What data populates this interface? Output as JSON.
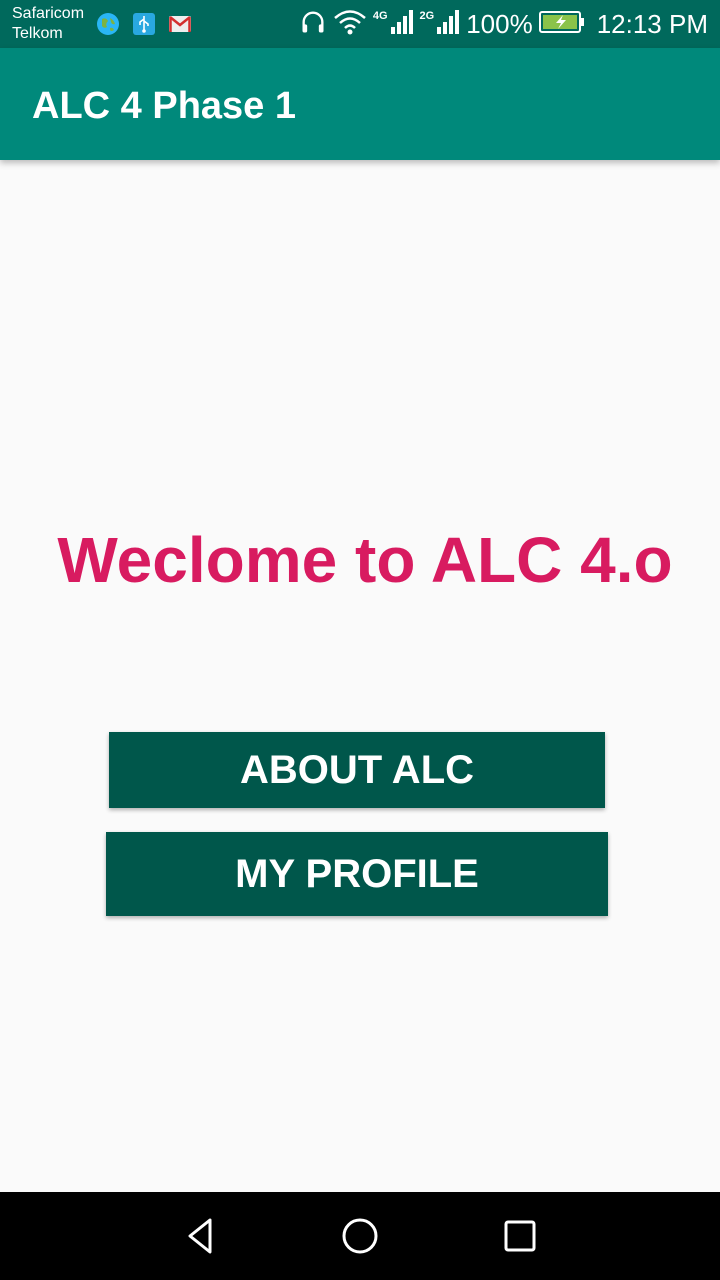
{
  "status_bar": {
    "carrier_1": "Safaricom",
    "carrier_2": "Telkom",
    "network_1": "4G",
    "network_2": "2G",
    "battery": "100%",
    "time": "12:13 PM",
    "icons": [
      "globe-icon",
      "usb-icon",
      "gmail-icon",
      "headphones-icon",
      "wifi-icon",
      "signal-icon",
      "battery-charging-icon"
    ]
  },
  "app_bar": {
    "title": "ALC 4 Phase 1"
  },
  "main": {
    "welcome_text": "Weclome to ALC 4.o",
    "about_button": "ABOUT ALC",
    "profile_button": "MY PROFILE"
  },
  "nav_bar": {
    "icons": [
      "back-icon",
      "home-icon",
      "recent-apps-icon"
    ]
  },
  "colors": {
    "status_bar": "#00695c",
    "app_bar": "#00897b",
    "accent": "#d81b60",
    "button": "#00574b",
    "background": "#fafafa"
  }
}
